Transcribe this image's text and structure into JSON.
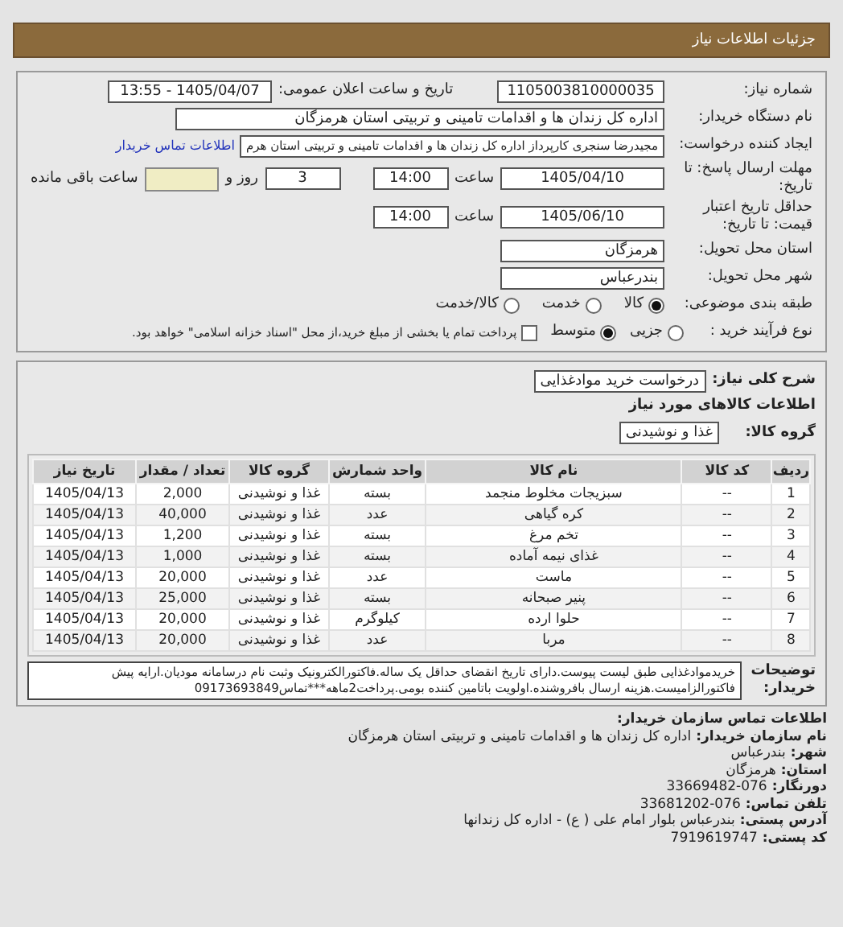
{
  "header": {
    "title": "جزئیات اطلاعات نیاز"
  },
  "need_number": {
    "label": "شماره نیاز:",
    "value": "1105003810000035"
  },
  "announce": {
    "label": "تاریخ و ساعت اعلان عمومی:",
    "value": "1405/04/07 - 13:55"
  },
  "buyer": {
    "label": "نام دستگاه خریدار:",
    "value": "اداره کل زندان ها و اقدامات تامینی و تربیتی استان هرمزگان"
  },
  "creator": {
    "label": "ایجاد کننده درخواست:",
    "value": "مجیدرضا سنجری کارپرداز اداره کل زندان ها و اقدامات تامینی و تربیتی استان هرم",
    "link": "اطلاعات تماس خریدار"
  },
  "deadline": {
    "label": "مهلت ارسال پاسخ: تا تاریخ:",
    "date": "1405/04/10",
    "time_label": "ساعت",
    "time": "14:00",
    "days": "3",
    "days_label": "روز و",
    "remaining_label": "ساعت باقی مانده"
  },
  "validity": {
    "label": "حداقل تاریخ اعتبار قیمت: تا تاریخ:",
    "date": "1405/06/10",
    "time_label": "ساعت",
    "time": "14:00"
  },
  "province": {
    "label": "استان محل تحویل:",
    "value": "هرمزگان"
  },
  "city": {
    "label": "شهر محل تحویل:",
    "value": "بندرعباس"
  },
  "category": {
    "label": "طبقه بندی موضوعی:",
    "options": [
      {
        "label": "کالا",
        "selected": true
      },
      {
        "label": "خدمت",
        "selected": false
      },
      {
        "label": "کالا/خدمت",
        "selected": false
      }
    ]
  },
  "process": {
    "label": "نوع فرآیند خرید :",
    "options": [
      {
        "label": "جزیی",
        "selected": false
      },
      {
        "label": "متوسط",
        "selected": true
      }
    ],
    "payment": {
      "checked": false,
      "text": "پرداخت تمام یا بخشی از مبلغ خرید،از محل \"اسناد خزانه اسلامی\" خواهد بود."
    }
  },
  "summary": {
    "label": "شرح کلی نیاز:",
    "value": "درخواست خرید موادغذایی"
  },
  "goods_title": "اطلاعات کالاهای مورد نیاز",
  "goods_group": {
    "label": "گروه کالا:",
    "value": "غذا و نوشیدنی"
  },
  "table": {
    "columns": [
      "ردیف",
      "کد کالا",
      "نام کالا",
      "واحد شمارش",
      "گروه کالا",
      "تعداد / مقدار",
      "تاریخ نیاز"
    ],
    "rows": [
      [
        "1",
        "--",
        "سبزیجات مخلوط منجمد",
        "بسته",
        "غذا و نوشیدنی",
        "2,000",
        "1405/04/13"
      ],
      [
        "2",
        "--",
        "کره گیاهی",
        "عدد",
        "غذا و نوشیدنی",
        "40,000",
        "1405/04/13"
      ],
      [
        "3",
        "--",
        "تخم مرغ",
        "بسته",
        "غذا و نوشیدنی",
        "1,200",
        "1405/04/13"
      ],
      [
        "4",
        "--",
        "غذای نیمه آماده",
        "بسته",
        "غذا و نوشیدنی",
        "1,000",
        "1405/04/13"
      ],
      [
        "5",
        "--",
        "ماست",
        "عدد",
        "غذا و نوشیدنی",
        "20,000",
        "1405/04/13"
      ],
      [
        "6",
        "--",
        "پنیر صبحانه",
        "بسته",
        "غذا و نوشیدنی",
        "25,000",
        "1405/04/13"
      ],
      [
        "7",
        "--",
        "حلوا ارده",
        "کیلوگرم",
        "غذا و نوشیدنی",
        "20,000",
        "1405/04/13"
      ],
      [
        "8",
        "--",
        "مربا",
        "عدد",
        "غذا و نوشیدنی",
        "20,000",
        "1405/04/13"
      ]
    ]
  },
  "notes": {
    "label": "توضیحات خریدار:",
    "value": "خریدموادغذایی طبق لیست پیوست.دارای تاریخ انقضای حداقل یک ساله.فاکتورالکترونیک وثبت نام درسامانه مودیان.ارایه پیش فاکتورالزامیست.هزینه ارسال بافروشنده.اولویت باتامین کننده بومی.پرداخت2ماهه***تماس09173693849"
  },
  "contact": {
    "title": "اطلاعات تماس سازمان خریدار:",
    "fields": [
      {
        "label": "نام سازمان خریدار:",
        "value": "اداره کل زندان ها و اقدامات تامینی و تربیتی استان هرمزگان"
      },
      {
        "label": "شهر:",
        "value": "بندرعباس"
      },
      {
        "label": "استان:",
        "value": "هرمزگان"
      },
      {
        "label": "دورنگار:",
        "value": "076-33669482"
      },
      {
        "label": "تلفن تماس:",
        "value": "076-33681202"
      },
      {
        "label": "آدرس پستی:",
        "value": "بندرعباس بلوار امام علی ( ع) - اداره کل زندانها"
      },
      {
        "label": "کد پستی:",
        "value": "7919619747"
      }
    ]
  }
}
